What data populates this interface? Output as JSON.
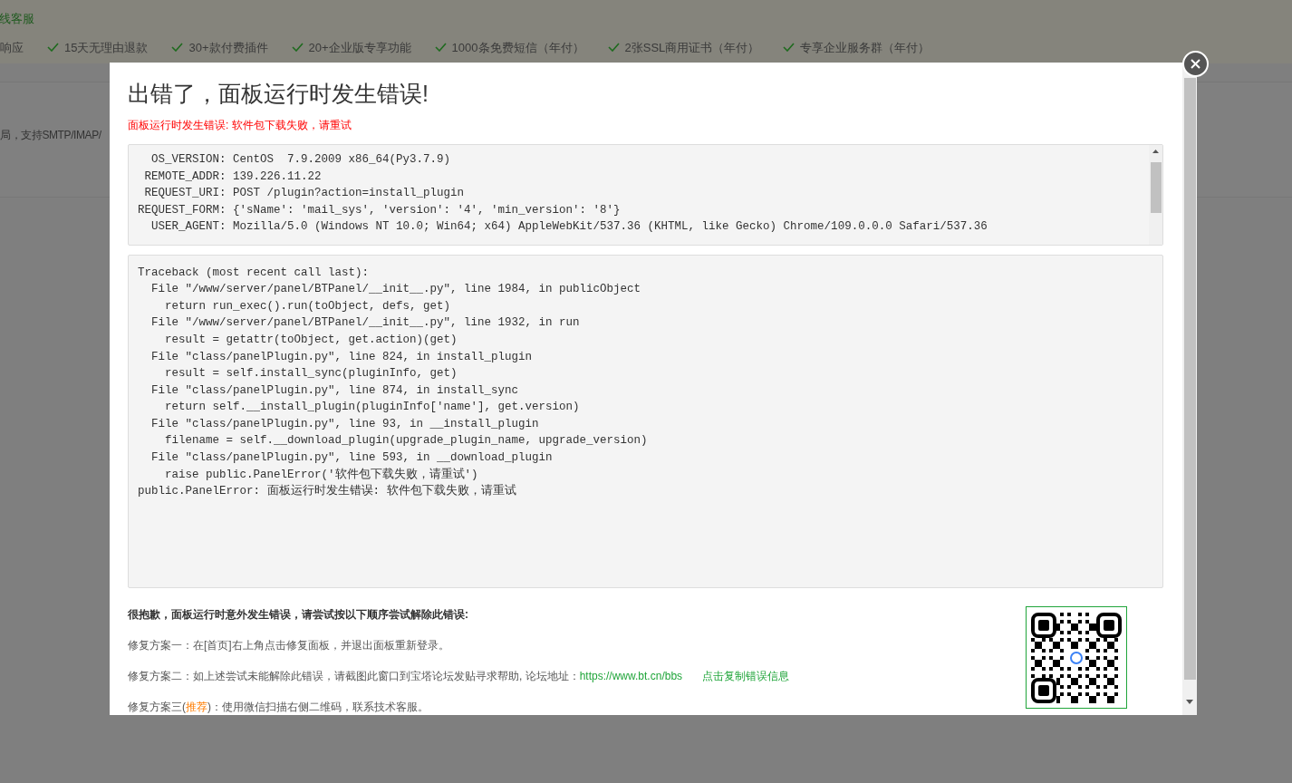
{
  "background": {
    "service_link": "线客服",
    "features": [
      {
        "text": "响应",
        "checked": false
      },
      {
        "text": "15天无理由退款",
        "checked": true
      },
      {
        "text": "30+款付费插件",
        "checked": true
      },
      {
        "text": "20+企业版专享功能",
        "checked": true
      },
      {
        "text": "1000条免费短信（年付）",
        "checked": true
      },
      {
        "text": "2张SSL商用证书（年付）",
        "checked": true
      },
      {
        "text": "专享企业服务群（年付）",
        "checked": true
      }
    ],
    "description": "局，支持SMTP/IMAP/"
  },
  "dialog": {
    "title": "出错了，面板运行时发生错误!",
    "subtitle": "面板运行时发生错误: 软件包下载失败，请重试",
    "info_lines": [
      "  OS_VERSION: CentOS  7.9.2009 x86_64(Py3.7.9)",
      " REMOTE_ADDR: 139.226.11.22",
      " REQUEST_URI: POST /plugin?action=install_plugin",
      "REQUEST_FORM: {'sName': 'mail_sys', 'version': '4', 'min_version': '8'}",
      "  USER_AGENT: Mozilla/5.0 (Windows NT 10.0; Win64; x64) AppleWebKit/537.36 (KHTML, like Gecko) Chrome/109.0.0.0 Safari/537.36"
    ],
    "traceback": [
      "Traceback (most recent call last):",
      "  File \"/www/server/panel/BTPanel/__init__.py\", line 1984, in publicObject",
      "    return run_exec().run(toObject, defs, get)",
      "  File \"/www/server/panel/BTPanel/__init__.py\", line 1932, in run",
      "    result = getattr(toObject, get.action)(get)",
      "  File \"class/panelPlugin.py\", line 824, in install_plugin",
      "    result = self.install_sync(pluginInfo, get)",
      "  File \"class/panelPlugin.py\", line 874, in install_sync",
      "    return self.__install_plugin(pluginInfo['name'], get.version)",
      "  File \"class/panelPlugin.py\", line 93, in __install_plugin",
      "    filename = self.__download_plugin(upgrade_plugin_name, upgrade_version)",
      "  File \"class/panelPlugin.py\", line 593, in __download_plugin",
      "    raise public.PanelError('软件包下载失败，请重试')",
      "public.PanelError: 面板运行时发生错误: 软件包下载失败，请重试"
    ],
    "help_heading": "很抱歉，面板运行时意外发生错误，请尝试按以下顺序尝试解除此错误:",
    "fix_one": "修复方案一：在[首页]右上角点击修复面板，并退出面板重新登录。",
    "fix_two": {
      "text": "修复方案二：如上述尝试未能解除此错误，请截图此窗口到宝塔论坛发贴寻求帮助, 论坛地址：",
      "link": "https://www.bt.cn/bbs",
      "copy_link": "点击复制错误信息"
    },
    "fix_three": {
      "prefix": "修复方案三(",
      "highlight": "推荐",
      "suffix": ")：使用微信扫描右侧二维码，联系技术客服。"
    }
  }
}
